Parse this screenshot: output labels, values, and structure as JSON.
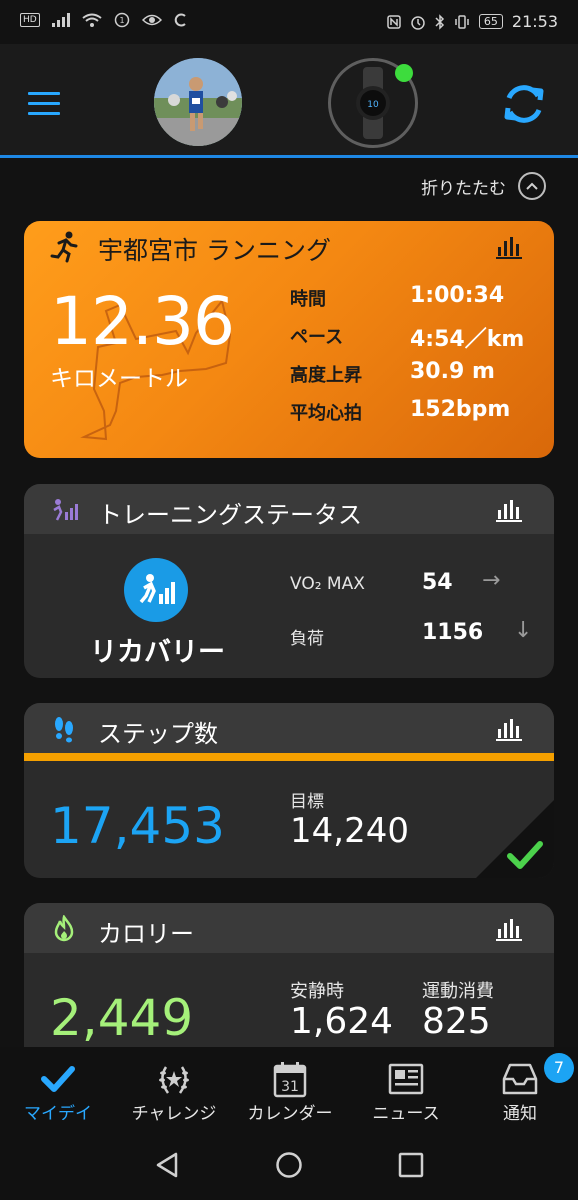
{
  "status_bar": {
    "hd": "HD",
    "battery": "65",
    "time": "21:53"
  },
  "header": {
    "menu_icon": "hamburger-menu-icon",
    "sync_icon": "sync-icon",
    "device_connected_color": "#3ddc3d",
    "accent_color": "#1e88e5"
  },
  "collapse": {
    "label": "折りたたむ"
  },
  "run_card": {
    "title": "宇都宮市 ランニング",
    "distance": "12.36",
    "distance_unit": "キロメートル",
    "stats": [
      {
        "label": "時間",
        "value": "1:00:34"
      },
      {
        "label": "ペース",
        "value": "4:54／km"
      },
      {
        "label": "高度上昇",
        "value": "30.9 m"
      },
      {
        "label": "平均心拍",
        "value": "152bpm"
      }
    ],
    "color": "#f48812"
  },
  "training_card": {
    "title": "トレーニングステータス",
    "status": "リカバリー",
    "vo2_label": "VO₂ MAX",
    "vo2_value": "54",
    "vo2_trend": "→",
    "load_label": "負荷",
    "load_value": "1156",
    "load_trend": "↓"
  },
  "steps_card": {
    "title": "ステップ数",
    "steps": "17,453",
    "goal_label": "目標",
    "goal_value": "14,240",
    "progress": 1.0,
    "bar_color": "#f5a000",
    "value_color": "#1ca4f4"
  },
  "calories_card": {
    "title": "カロリー",
    "total": "2,449",
    "resting_label": "安静時",
    "resting_value": "1,624",
    "active_label": "運動消費",
    "active_value": "825",
    "value_color": "#a5f07a"
  },
  "bottom_nav": {
    "items": [
      {
        "label": "マイデイ",
        "icon": "checkmark-icon"
      },
      {
        "label": "チャレンジ",
        "icon": "laurel-icon"
      },
      {
        "label": "カレンダー",
        "icon": "calendar-icon",
        "day": "31"
      },
      {
        "label": "ニュース",
        "icon": "newspaper-icon"
      },
      {
        "label": "通知",
        "icon": "inbox-icon"
      }
    ],
    "badge": "7"
  }
}
